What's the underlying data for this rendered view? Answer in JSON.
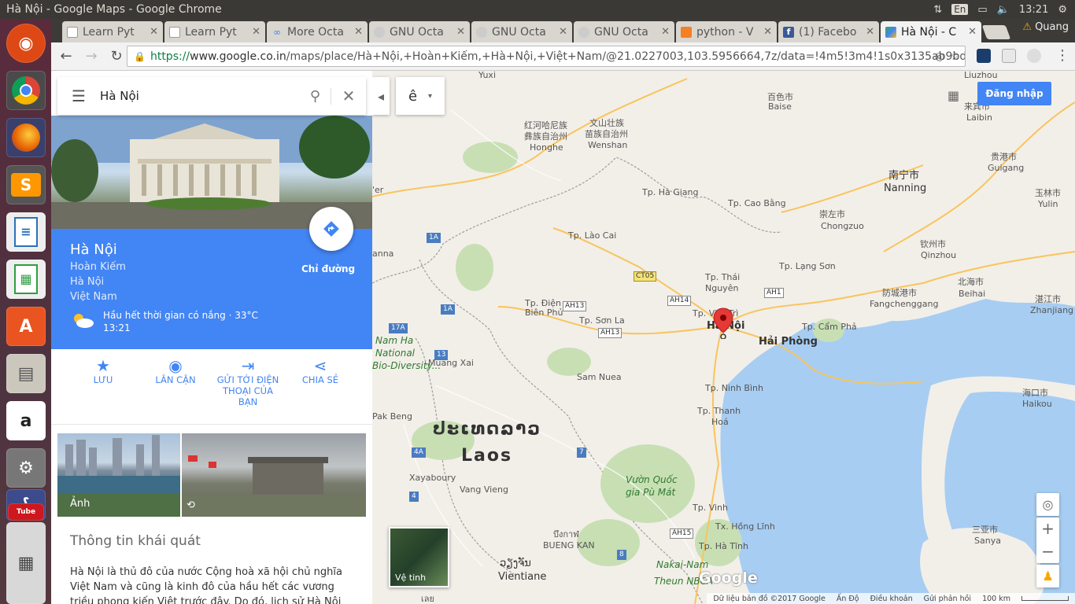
{
  "window": {
    "title": "Hà Nội - Google Maps - Google Chrome"
  },
  "tray": {
    "lang": "En",
    "time": "13:21",
    "user": "Quang"
  },
  "tabs": [
    {
      "label": "Learn Pyt",
      "fav": "doc"
    },
    {
      "label": "Learn Pyt",
      "fav": "doc"
    },
    {
      "label": "More Octa",
      "fav": "infinity"
    },
    {
      "label": "GNU Octa",
      "fav": "gnu"
    },
    {
      "label": "GNU Octa",
      "fav": "gnu"
    },
    {
      "label": "GNU Octa",
      "fav": "gnu"
    },
    {
      "label": "python - V",
      "fav": "stack"
    },
    {
      "label": "(1) Facebo",
      "fav": "facebook"
    },
    {
      "label": "Hà Nội - C",
      "fav": "maps",
      "active": true
    }
  ],
  "toolbar": {
    "url_scheme": "https://",
    "url_host": "www.google.co.in",
    "url_path": "/maps/place/Hà+Nội,+Hoàn+Kiếm,+Hà+Nội,+Việt+Nam/@21.0227003,103.5956664,7z/data=!4m5!3m4!1s0x3135ab9bd9861ca1:0xe"
  },
  "search": {
    "query": "Hà Nội"
  },
  "place": {
    "name": "Hà Nội",
    "line1": "Hoàn Kiếm",
    "line2": "Hà Nội",
    "line3": "Việt Nam",
    "directions_label": "Chỉ đường",
    "weather_text": "Hầu hết thời gian có nắng · 33°C",
    "weather_time": "13:21"
  },
  "actions": {
    "save": "LƯU",
    "nearby": "LÂN CẬN",
    "send_l1": "GỬI TỚI ĐIỆN",
    "send_l2": "THOẠI CỦA",
    "send_l3": "BẠN",
    "share": "CHIA SẺ"
  },
  "photos": {
    "label": "Ảnh"
  },
  "overview": {
    "title": "Thông tin khái quát",
    "text": "Hà Nội là thủ đô của nước Cộng hoà xã hội chủ nghĩa Việt Nam và cũng là kinh đô của hầu hết các vương triều phong kiến Việt trước đây. Do đó, lịch sử Hà Nội gắn liền với sự thăng"
  },
  "map": {
    "signin": "Đăng nhập",
    "layer_letter": "ê",
    "satellite": "Vệ tinh",
    "labels": {
      "yuxi": "Yuxi",
      "baise_cn": "百色市",
      "baise": "Baise",
      "laibin_cn": "来宾市",
      "laibin": "Laibin",
      "liuzhou": "Liuzhou",
      "honghe_cn1": "红河哈尼族",
      "honghe_cn2": "彝族自治州",
      "honghe": "Honghe",
      "wenshan_cn1": "文山壮族",
      "wenshan_cn2": "苗族自治州",
      "wenshan": "Wenshan",
      "nanning_cn": "南宁市",
      "nanning": "Nanning",
      "guigang_cn": "贵港市",
      "guigang": "Guigang",
      "yulin_cn": "玉林市",
      "yulin": "Yulin",
      "chongzuo_cn": "崇左市",
      "chongzuo": "Chongzuo",
      "qinzhou_cn": "钦州市",
      "qinzhou": "Qinzhou",
      "beihai_cn": "北海市",
      "beihai": "Beihai",
      "fangcheng_cn": "防城港市",
      "fangcheng": "Fangchenggang",
      "zhanjiang_cn": "湛江市",
      "zhanjiang": "Zhanjiang",
      "haikou_cn": "海口市",
      "haikou": "Haikou",
      "sanya_cn": "三亚市",
      "sanya": "Sanya",
      "hagiang": "Tp. Hà Giang",
      "caobang": "Tp. Cao Bằng",
      "laocai": "Tp. Lào Cai",
      "langson": "Tp. Lạng Sơn",
      "thainguyen1": "Tp. Thái",
      "thainguyen2": "Nguyên",
      "vietri": "Tp. Việt Trì",
      "hanoi": "Hà Nội",
      "haiphong": "Hải Phòng",
      "camphat": "Tp. Cẩm Phả",
      "dienbien1": "Tp. Điện",
      "dienbien2": "Biên Phủ",
      "sonla": "Tp. Sơn La",
      "ninhbinh": "Tp. Ninh Bình",
      "thanhhoa1": "Tp. Thanh",
      "thanhhoa2": "Hoá",
      "vinh": "Tp. Vinh",
      "honglinh": "Tx. Hồng Lĩnh",
      "hatinh": "Tp. Hà Tĩnh",
      "samnuea": "Sam Nuea",
      "muangxai": "Muang Xai",
      "pakbeng": "Pak Beng",
      "xayabury": "Xayaboury",
      "vangvieng": "Vang Vieng",
      "vientiane_lo": "ວຽງຈັນ",
      "vientiane": "Vientiane",
      "laos_lo": "ປະເທດລາວ",
      "laos": "Laos",
      "namha1": "Nam Ha",
      "namha2": "National",
      "namha3": "Bio-Diversity...",
      "puMat1": "Vườn Quốc",
      "puMat2": "gia Pù Mát",
      "nakai1": "Nakai-Nam",
      "nakai2": "Theun NBCA",
      "buengkan_th": "บึงกาฬ",
      "buengkan": "BUENG KAN",
      "er": "'er",
      "anna": "anna",
      "leui": "เลย"
    },
    "roads": {
      "r1a": "1A",
      "r1a2": "1A",
      "r17a": "17A",
      "r13": "13",
      "r4a": "4A",
      "r4": "4",
      "r7": "7",
      "r8": "8",
      "ah13a": "AH13",
      "ah13b": "AH13",
      "ah14": "AH14",
      "ah1": "AH1",
      "ah15": "AH15",
      "ct05": "CT05"
    },
    "attribution": {
      "data": "Dữ liệu bản đồ ©2017 Google",
      "india": "Ấn Độ",
      "terms": "Điều khoản",
      "feedback": "Gửi phản hồi",
      "scale": "100 km"
    },
    "logo": "Google"
  }
}
